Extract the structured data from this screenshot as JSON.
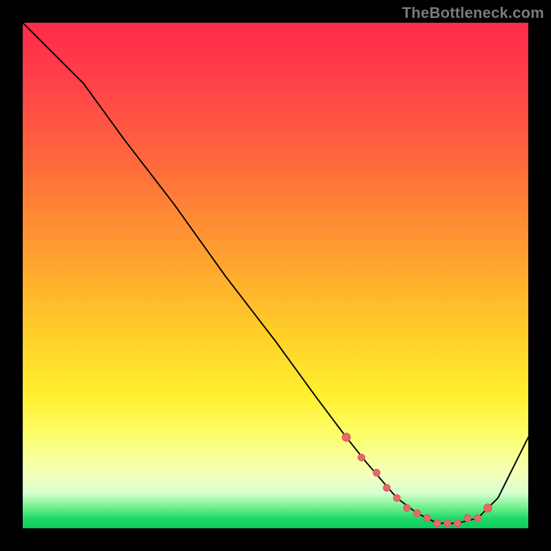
{
  "watermark": "TheBottleneck.com",
  "colors": {
    "background": "#000000",
    "gradient_top": "#ff2a4a",
    "gradient_mid1": "#ff9a30",
    "gradient_mid2": "#fff030",
    "gradient_bottom": "#0acc5a",
    "curve": "#000000",
    "dots": "#e46a6a"
  },
  "chart_data": {
    "type": "line",
    "title": "",
    "xlabel": "",
    "ylabel": "",
    "xlim": [
      0,
      100
    ],
    "ylim": [
      0,
      100
    ],
    "series": [
      {
        "name": "curve",
        "x": [
          0,
          8,
          12,
          20,
          30,
          40,
          50,
          58,
          64,
          68,
          74,
          78,
          82,
          86,
          90,
          94,
          100
        ],
        "y": [
          100,
          92,
          88,
          77,
          64,
          50,
          37,
          26,
          18,
          13,
          6,
          3,
          1,
          1,
          2,
          6,
          18
        ]
      }
    ],
    "markers": {
      "name": "dots",
      "x": [
        64,
        67,
        70,
        72,
        74,
        76,
        78,
        80,
        82,
        84,
        86,
        88,
        90,
        92
      ],
      "y": [
        18,
        14,
        11,
        8,
        6,
        4,
        3,
        2,
        1,
        1,
        1,
        2,
        2,
        4
      ]
    },
    "annotations": []
  }
}
